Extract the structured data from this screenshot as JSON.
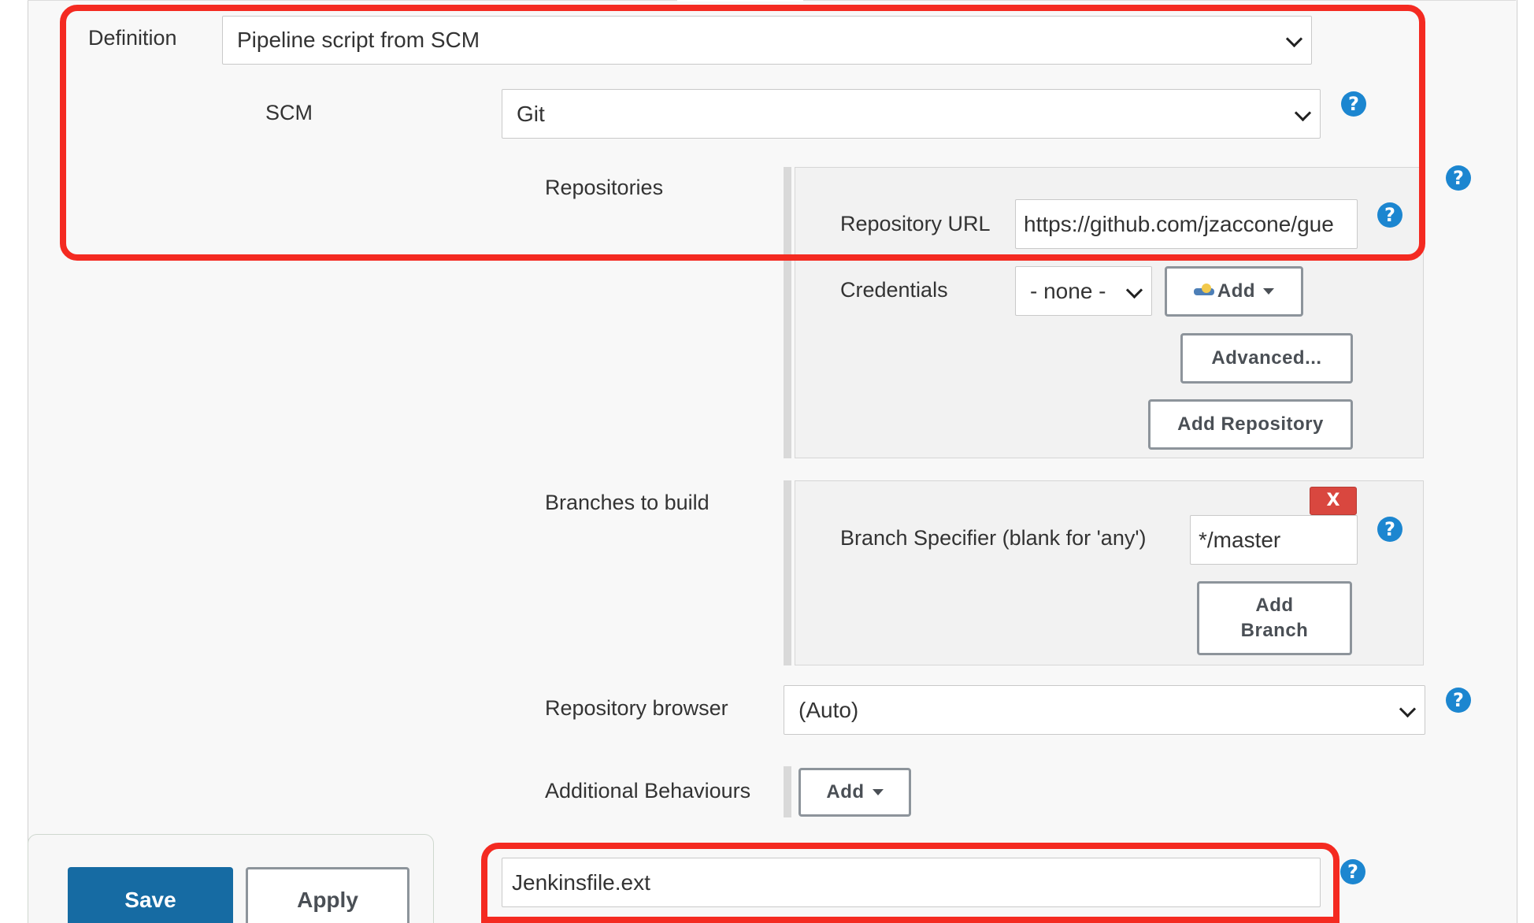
{
  "definition": {
    "label": "Definition",
    "selected": "Pipeline script from SCM"
  },
  "scm": {
    "label": "SCM",
    "selected": "Git"
  },
  "repositories": {
    "label": "Repositories",
    "repository_url_label": "Repository URL",
    "repository_url_value": "https://github.com/jzaccone/gue",
    "credentials_label": "Credentials",
    "credentials_selected": "- none -",
    "add_credentials_label": "Add",
    "advanced_label": "Advanced...",
    "add_repository_label": "Add Repository"
  },
  "branches": {
    "label": "Branches to build",
    "delete_label": "X",
    "branch_specifier_label": "Branch Specifier (blank for 'any')",
    "branch_specifier_value": "*/master",
    "add_branch_line1": "Add",
    "add_branch_line2": "Branch"
  },
  "repository_browser": {
    "label": "Repository browser",
    "selected": "(Auto)"
  },
  "additional_behaviours": {
    "label": "Additional Behaviours",
    "add_label": "Add"
  },
  "script_path": {
    "value": "Jenkinsfile.ext"
  },
  "footer": {
    "save_label": "Save",
    "apply_label": "Apply"
  },
  "help": {
    "symbol": "?"
  },
  "colors": {
    "highlight": "#f42a21",
    "help_icon": "#1c86d0",
    "save_button": "#166ba3",
    "delete_button": "#d9473f"
  }
}
